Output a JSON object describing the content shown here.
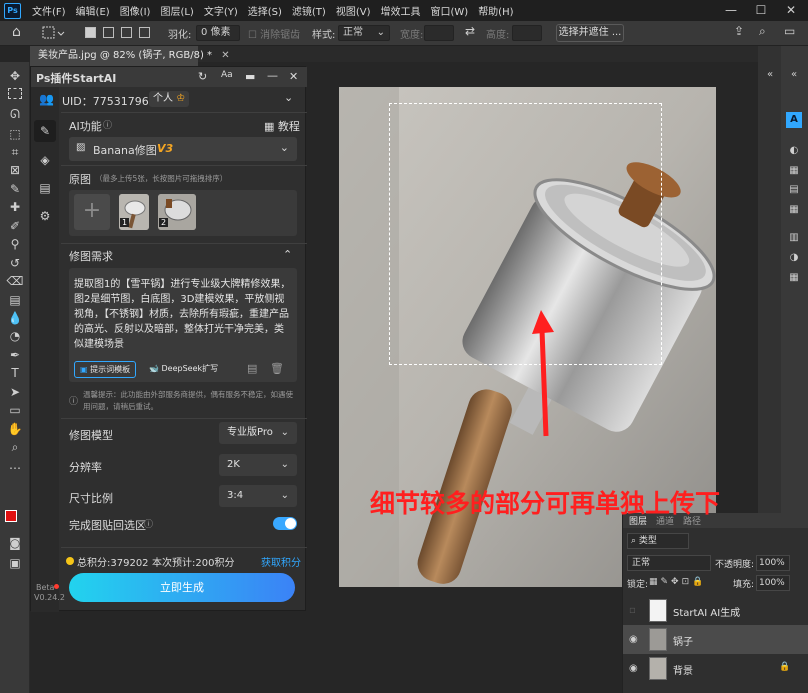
{
  "menubar": {
    "logo": "Ps",
    "items": [
      "文件(F)",
      "编辑(E)",
      "图像(I)",
      "图层(L)",
      "文字(Y)",
      "选择(S)",
      "滤镜(T)",
      "视图(V)",
      "增效工具",
      "窗口(W)",
      "帮助(H)"
    ],
    "win_min": "—",
    "win_max": "☐",
    "win_close": "✕"
  },
  "options_bar": {
    "feather_label": "羽化:",
    "feather_value": "0 像素",
    "antialias_label": "消除锯齿",
    "style_label": "样式:",
    "style_value": "正常",
    "width_label": "宽度:",
    "height_label": "高度:",
    "select_mask_button": "选择并遮住 ..."
  },
  "document_tab": {
    "title": "美妆产品.jpg @ 82% (锅子, RGB/8) *",
    "close": "✕"
  },
  "plugin": {
    "title": "Ps插件StartAI",
    "uid_label": "UID：775317965",
    "personal_badge": "个人",
    "ai_function_label": "AI功能",
    "tutorial_label": "教程",
    "model_select_value": "Banana修图",
    "model_select_version": "V3",
    "source_label": "原图",
    "source_hint": "（最多上传5张，长按图片可拖拽排序）",
    "thumb_badges": [
      "1",
      "2"
    ],
    "requirement_label": "修图需求",
    "prompt_text": "提取图1的【雪平锅】进行专业级大牌精修效果，图2是细节图，白底图，3D建模效果，平放侧视视角，【不锈钢】材质，去除所有瑕疵，重建产品的高光、反射以及暗部，整体打光干净完美，类似建模场景",
    "prompt_template_button": "提示词模板",
    "deepseek_button": "DeepSeek扩写",
    "notice_text": "温馨提示：此功能由外部服务商提供，偶有服务不稳定，如遇使用问题，请稍后重试。",
    "model_label": "修图模型",
    "model_value": "专业版Pro",
    "resolution_label": "分辨率",
    "resolution_value": "2K",
    "ratio_label": "尺寸比例",
    "ratio_value": "3:4",
    "paste_back_label": "完成图贴回选区",
    "paste_back_on": true,
    "total_points": "总积分:379202",
    "estimate": "本次预计:200积分",
    "get_points": "获取积分",
    "generate_button": "立即生成",
    "beta_label": "Beta",
    "version_label": "V0.24.2"
  },
  "layers_panel": {
    "tabs": [
      "图层",
      "通道",
      "路径"
    ],
    "kind_label": "类型",
    "blend_mode": "正常",
    "opacity_label": "不透明度:",
    "opacity_value": "100%",
    "lock_label": "锁定:",
    "fill_label": "填充:",
    "fill_value": "100%",
    "layers": [
      {
        "name": "StartAI AI生成",
        "visible": false
      },
      {
        "name": "锅子",
        "visible": true
      },
      {
        "name": "背景",
        "visible": true
      }
    ]
  },
  "annotation_text": "细节较多的部分可再单独上传下",
  "colors": {
    "accent": "#31a8ff",
    "generate_gradient_start": "#22d3ee",
    "generate_gradient_end": "#3b82f6",
    "annotation": "#ff1f1f",
    "version_badge": "#f5a623",
    "toggle": "#39a8ff"
  }
}
